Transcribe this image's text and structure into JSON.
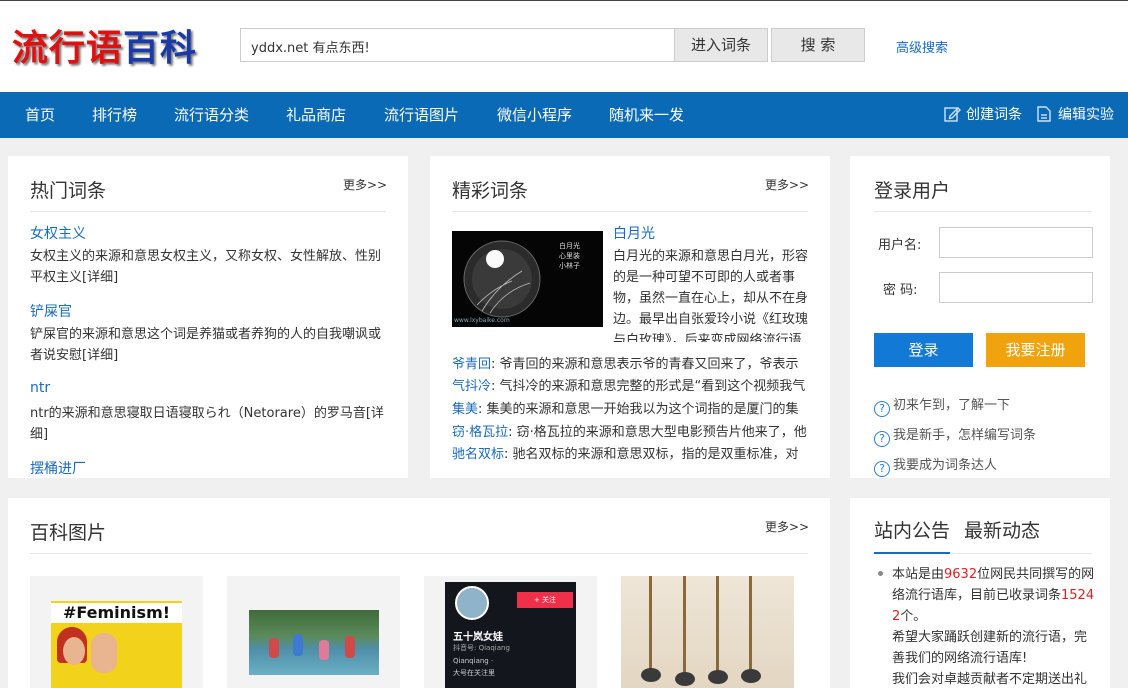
{
  "header": {
    "logo_part1": "流行语",
    "logo_part2": "百科",
    "search_value": "yddx.net 有点东西!",
    "enter_button": "进入词条",
    "search_button": "搜 索",
    "advanced_search": "高级搜索"
  },
  "nav": {
    "items": [
      "首页",
      "排行榜",
      "流行语分类",
      "礼品商店",
      "流行语图片",
      "微信小程序",
      "随机来一发"
    ],
    "create_entry": "创建词条",
    "edit_lab": "编辑实验"
  },
  "hot": {
    "title": "热门词条",
    "more": "更多>>",
    "entries": [
      {
        "title": "女权主义",
        "desc": "女权主义的来源和意思女权主义，又称女权、女性解放、性别平权主义[详细]"
      },
      {
        "title": "铲屎官",
        "desc": "铲屎官的来源和意思这个词是养猫或者养狗的人的自我嘲讽或者说安慰[详细]"
      },
      {
        "title": "ntr",
        "desc": "ntr的来源和意思寝取日语寝取られ（Netorare）的罗马音[详细]"
      },
      {
        "title": "摆桶进厂",
        "desc": ""
      }
    ]
  },
  "featured": {
    "title": "精彩词条",
    "more": "更多>>",
    "main_title": "白月光",
    "main_desc": "白月光的来源和意思白月光，形容的是一种可望不可即的人或者事物，虽然一直在心上，却从不在身边。最早出自张爱玲小说《红玫瑰与白玫瑰》，后来变成网络流行语",
    "image_caption": "白月光 心里装小林子",
    "image_watermark": "www.lxybaike.com",
    "rows": [
      {
        "key": "爷青回",
        "text": ": 爷青回的来源和意思表示爷的青春又回来了，爷表示"
      },
      {
        "key": "气抖冷",
        "text": ": 气抖冷的来源和意思完整的形式是“看到这个视频我气"
      },
      {
        "key": "集美",
        "text": ": 集美的来源和意思一开始我以为这个词指的是厦门的集"
      },
      {
        "key": "窃·格瓦拉",
        "text": ": 窃·格瓦拉的来源和意思大型电影预告片他来了，他"
      },
      {
        "key": "驰名双标",
        "text": ": 驰名双标的来源和意思双标，指的是双重标准，对"
      }
    ]
  },
  "login": {
    "title": "登录用户",
    "username_label": "用户名:",
    "password_label": "密  码:",
    "login_button": "登录",
    "register_button": "我要注册",
    "help": [
      "初来乍到，了解一下",
      "我是新手，怎样编写词条",
      "我要成为词条达人"
    ]
  },
  "pictures": {
    "title": "百科图片",
    "more": "更多>>",
    "thumb1_text": "#Feminism!",
    "thumb3_name": "五十岚女娃",
    "thumb3_sub": "抖音号: Qiaqiang",
    "thumb3_line1": "Qianqiang ·",
    "thumb3_line2": "大号在关注里",
    "thumb3_badge": "+ 关注"
  },
  "announcement": {
    "tab1": "站内公告",
    "tab2": "最新动态",
    "text_a": "本站是由",
    "count_users": "9632",
    "text_b": "位网民共同撰写的网络流行语库，目前已收录词条",
    "count_entries": "15242",
    "text_c": "个。",
    "line2": "希望大家踊跃创建新的流行语，完善我们的网络流行语库!",
    "line3": "我们会对卓越贡献者不定期送出礼"
  },
  "colors": {
    "nav_bg": "#0a6ab6",
    "link": "#1a6bbf",
    "login_button": "#1279d6",
    "register_button": "#f0a30c",
    "highlight": "#d22222"
  }
}
